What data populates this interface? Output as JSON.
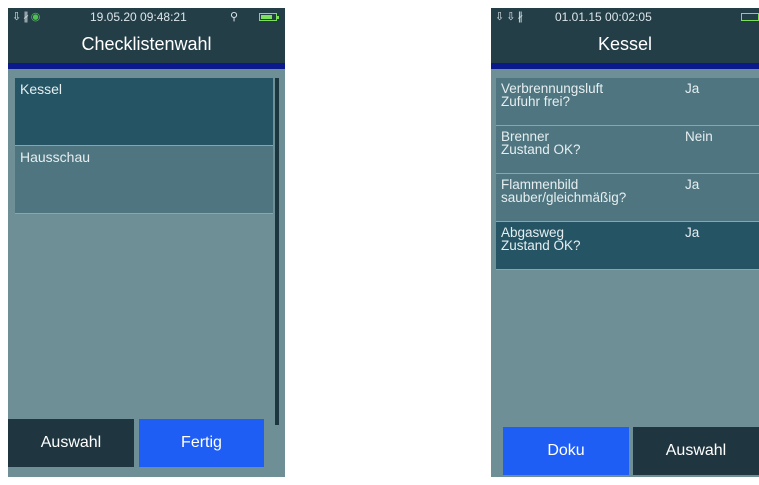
{
  "left": {
    "status": {
      "time": "19.05.20 09:48:21",
      "icons": [
        "usb-icon",
        "bluetooth-icon",
        "signal-dot-icon"
      ],
      "battery_level": 0.8
    },
    "title": "Checklistenwahl",
    "list": [
      {
        "label": "Kessel"
      },
      {
        "label": "Hausschau"
      }
    ],
    "buttons": {
      "select": "Auswahl",
      "done": "Fertig"
    }
  },
  "right": {
    "status": {
      "time": "01.01.15 00:02:05",
      "icons": [
        "usb-icon",
        "charge-icon",
        "bluetooth-icon"
      ]
    },
    "title": "Kessel",
    "items": [
      {
        "question": "Verbrennungsluft\nZufuhr frei?",
        "answer": "Ja"
      },
      {
        "question": "Brenner\nZustand OK?",
        "answer": "Nein"
      },
      {
        "question": "Flammenbild\nsauber/gleichmäßig?",
        "answer": "Ja"
      },
      {
        "question": "Abgasweg\nZustand OK?",
        "answer": "Ja"
      }
    ],
    "buttons": {
      "doc": "Doku",
      "select": "Auswahl"
    }
  },
  "colors": {
    "background": "#6e8f95",
    "header": "#243e48",
    "accent_line": "#0a1a8c",
    "selected_row": "#255564",
    "row": "#4f7680",
    "primary_button": "#1e5ef4",
    "secondary_button": "#1f3640",
    "battery": "#7de05a"
  }
}
